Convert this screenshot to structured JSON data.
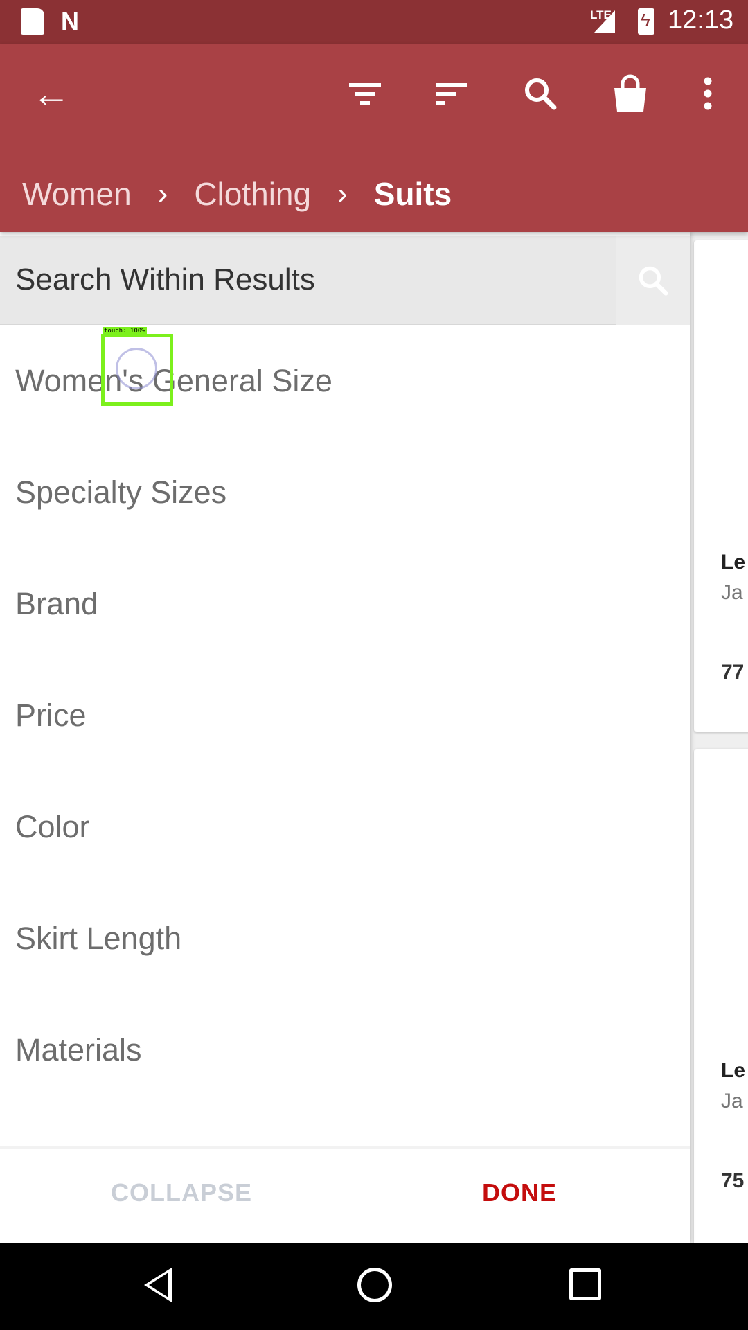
{
  "status_bar": {
    "network": "LTE",
    "time": "12:13",
    "icons": [
      "sd-card-icon",
      "n-notification-icon",
      "signal-icon",
      "battery-charging-icon"
    ]
  },
  "app_bar": {
    "icons": [
      "back-arrow-icon",
      "filter-icon",
      "sort-icon",
      "search-icon",
      "shopping-bag-icon",
      "more-vert-icon"
    ],
    "breadcrumb": [
      "Women",
      "Clothing",
      "Suits"
    ]
  },
  "filter_panel": {
    "search_placeholder": "Search Within Results",
    "items": [
      "Women's General Size",
      "Specialty Sizes",
      "Brand",
      "Price",
      "Color",
      "Skirt Length",
      "Materials"
    ],
    "collapse_label": "COLLAPSE",
    "done_label": "DONE"
  },
  "results_peek": [
    {
      "title": "Le",
      "subtitle": "Ja",
      "price": "77"
    },
    {
      "title": "Le",
      "subtitle": "Ja",
      "price": "75"
    }
  ],
  "touch_indicator": {
    "label": "touch: 100%"
  },
  "colors": {
    "status_bar": "#8b3134",
    "app_bar": "#a94145",
    "done": "#c40d0d",
    "collapse": "#c9ced6",
    "touch": "#7cf01c"
  }
}
